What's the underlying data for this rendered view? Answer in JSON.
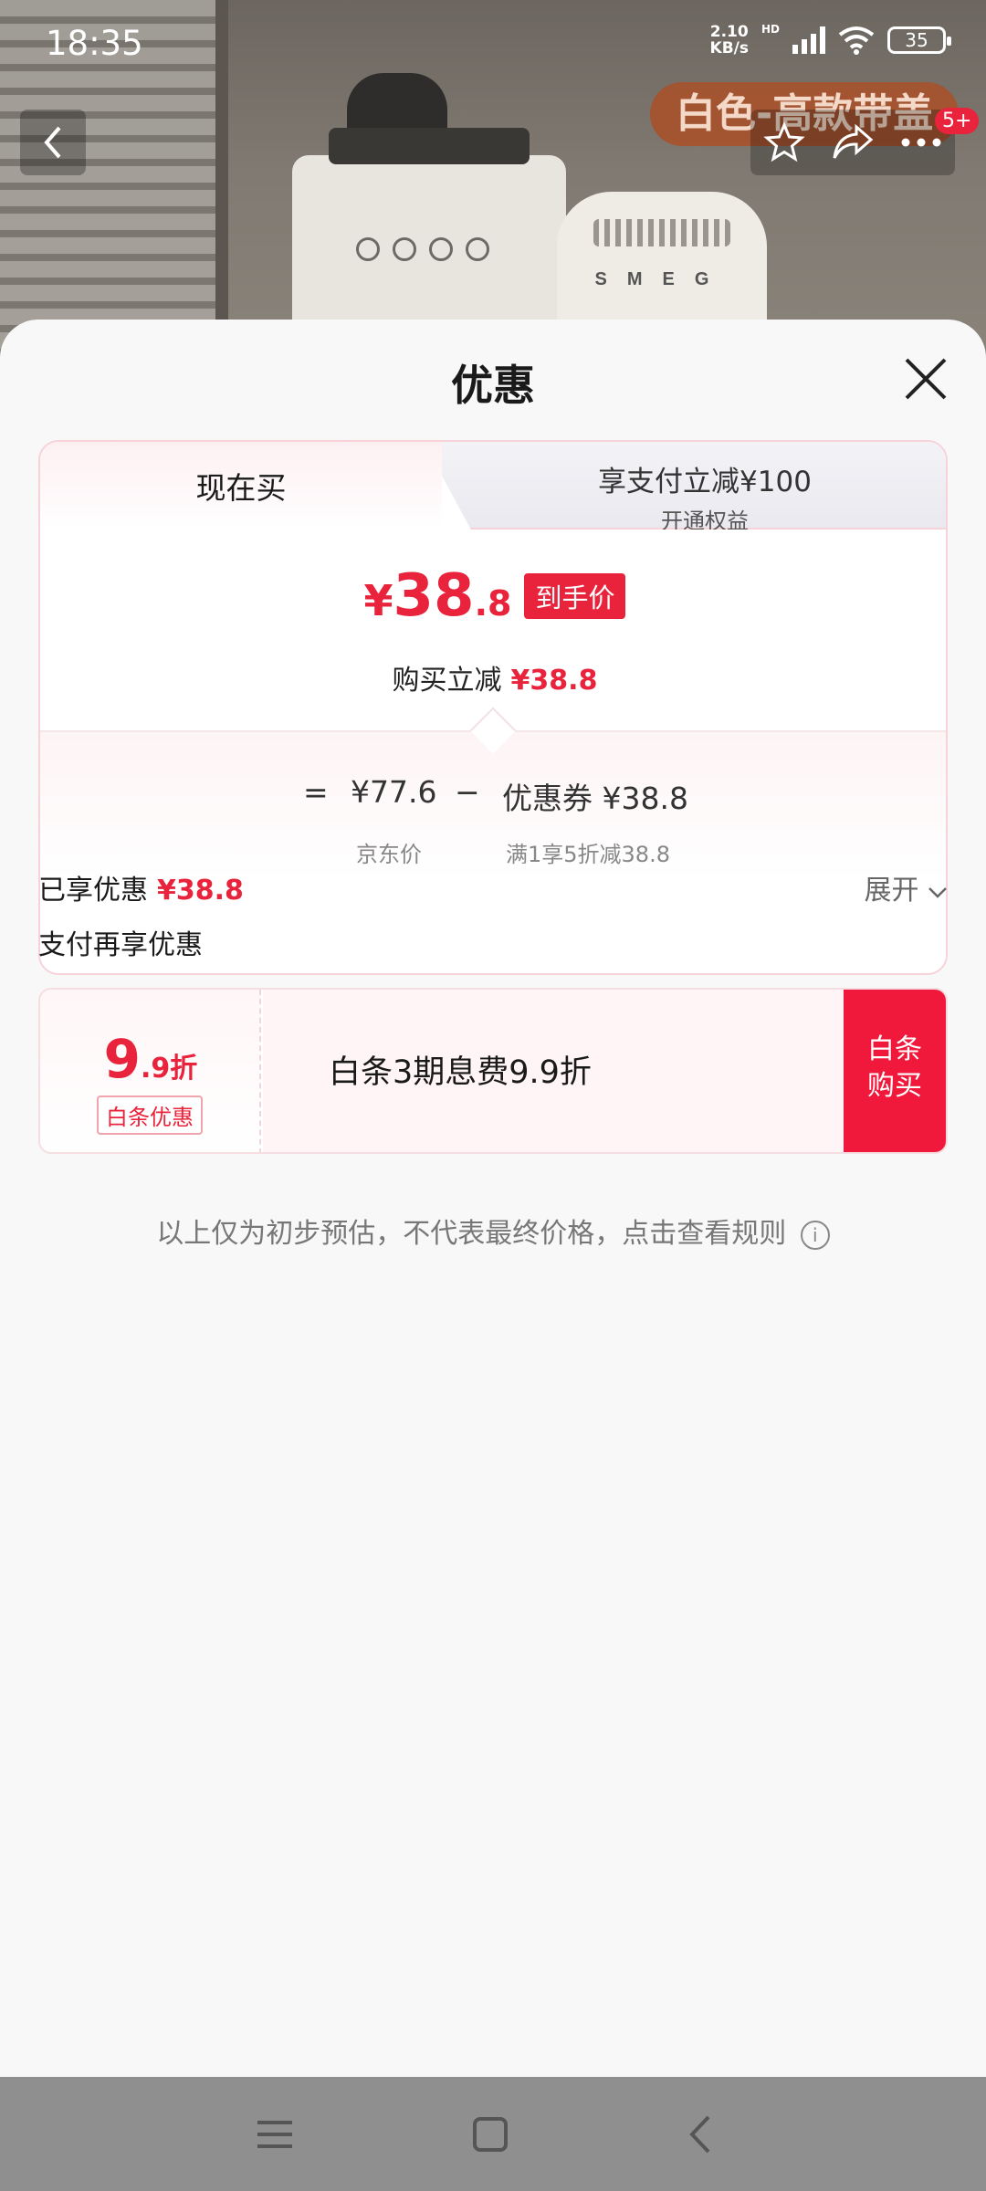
{
  "status_bar": {
    "time": "18:35",
    "net_speed_value": "2.10",
    "net_speed_unit": "KB/s",
    "hd": "HD",
    "battery": "35"
  },
  "product_header": {
    "variant_tag": "白色-高款带盖",
    "cart_badge": "5+",
    "machine_brand": "SMEG"
  },
  "sheet": {
    "title": "优惠",
    "tabs": {
      "now": "现在买",
      "pay_line1": "享支付立减¥100",
      "pay_line2": "开通权益"
    },
    "price": {
      "symbol": "¥",
      "integer": "38",
      "decimal": ".8",
      "tag": "到手价",
      "reduce_label": "购买立减",
      "reduce_value": "¥38.8"
    },
    "calc": {
      "equals": "=",
      "jd_price": "¥77.6",
      "minus": "−",
      "coupon": "优惠券 ¥38.8",
      "jd_price_label": "京东价",
      "coupon_detail": "满1享5折减38.8"
    },
    "enjoyed": {
      "label": "已享优惠",
      "value": "¥38.8",
      "expand": "展开"
    },
    "pay_more_label": "支付再享优惠",
    "baitiao": {
      "discount_big": "9",
      "discount_small": ".9折",
      "tag": "白条优惠",
      "text": "白条3期息费9.9折",
      "button": "白条购买"
    },
    "disclaimer": "以上仅为初步预估，不代表最终价格，点击查看规则"
  },
  "colors": {
    "accent_red": "#e8233b",
    "button_red": "#f0183b"
  }
}
